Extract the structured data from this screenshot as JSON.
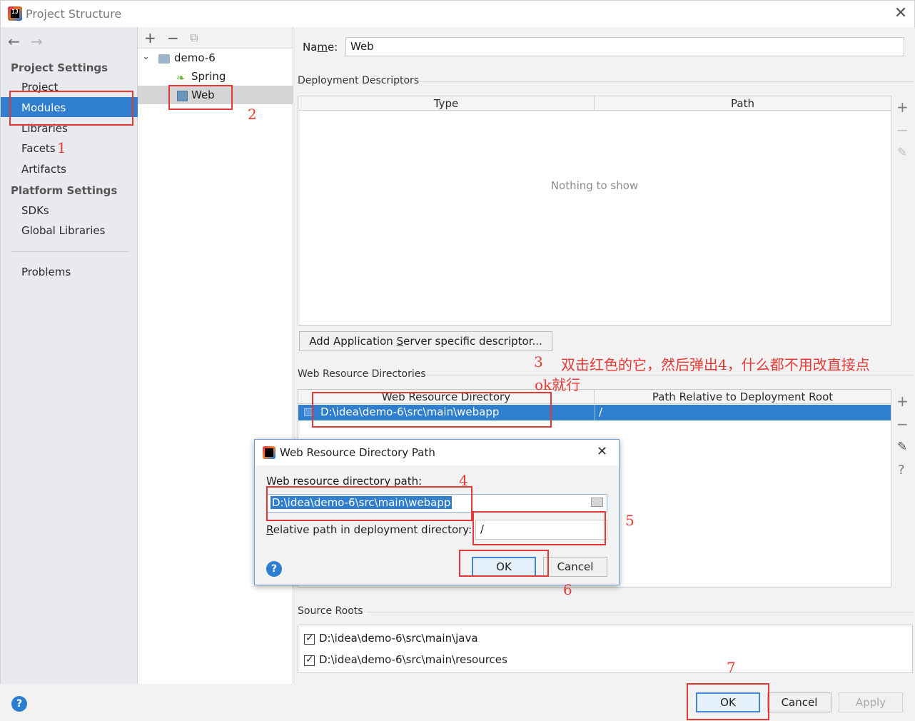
{
  "window": {
    "title": "Project Structure"
  },
  "sidebar": {
    "project_settings_title": "Project Settings",
    "project_items": [
      "Project",
      "Modules",
      "Libraries",
      "Facets",
      "Artifacts"
    ],
    "platform_settings_title": "Platform Settings",
    "platform_items": [
      "SDKs",
      "Global Libraries"
    ],
    "problems": "Problems"
  },
  "tree": {
    "root": "demo-6",
    "children": [
      "Spring",
      "Web"
    ]
  },
  "module": {
    "name_label_pre": "Na",
    "name_label_m": "m",
    "name_label_post": "e:",
    "name_value": "Web"
  },
  "deployment_descriptors": {
    "title": "Deployment Descriptors",
    "columns": [
      "Type",
      "Path"
    ],
    "empty_text": "Nothing to show",
    "add_button_pre": "Add Application ",
    "add_button_s": "S",
    "add_button_post": "erver specific descriptor..."
  },
  "web_resource_directories": {
    "title": "Web Resource Directories",
    "columns": [
      "Web Resource Directory",
      "Path Relative to Deployment Root"
    ],
    "rows": [
      {
        "directory": "D:\\idea\\demo-6\\src\\main\\webapp",
        "relative": "/"
      }
    ]
  },
  "source_roots": {
    "title": "Source Roots",
    "items": [
      "D:\\idea\\demo-6\\src\\main\\java",
      "D:\\idea\\demo-6\\src\\main\\resources"
    ]
  },
  "dialog": {
    "title": "Web Resource Directory Path",
    "path_label": "Web resource directory path:",
    "path_value": "D:\\idea\\demo-6\\src\\main\\webapp",
    "relative_label_r": "R",
    "relative_label_rest": "elative path in deployment directory:",
    "relative_value": "/",
    "ok": "OK",
    "cancel": "Cancel"
  },
  "footer": {
    "ok": "OK",
    "cancel": "Cancel",
    "apply": "Apply"
  },
  "annotations": {
    "n1": "1",
    "n2": "2",
    "n3": "3",
    "n4": "4",
    "n5": "5",
    "n6": "6",
    "n7": "7",
    "note_line1": "双击红色的它，然后弹出4，什么都不用改直接点",
    "note_line2": "ok就行"
  },
  "colors": {
    "selection": "#2f7fce",
    "annotation": "#e53935"
  }
}
